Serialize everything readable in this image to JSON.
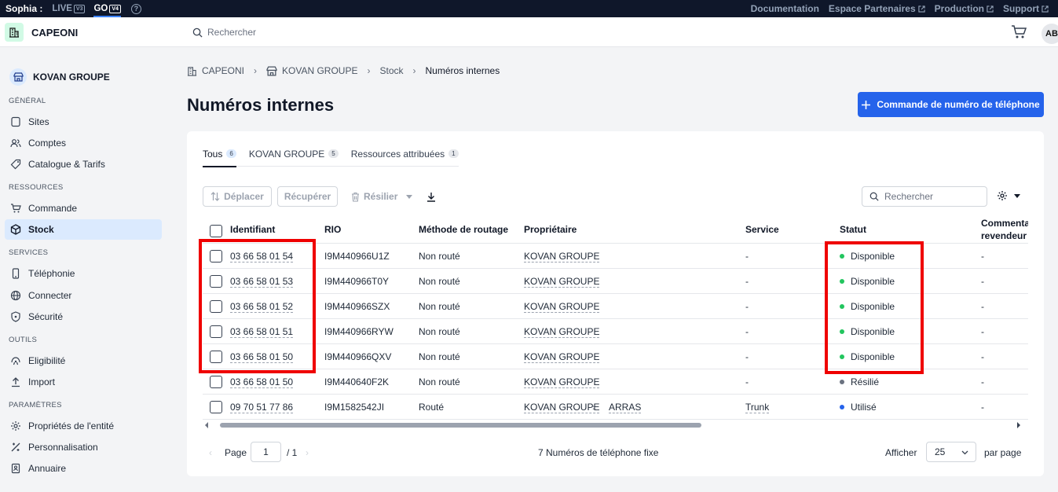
{
  "topbar": {
    "brand": "Sophia :",
    "env_live": "LIVE",
    "env_live_version": "V3",
    "env_go": "GO",
    "env_go_version": "V4",
    "help": "?",
    "links": [
      "Documentation",
      "Espace Partenaires",
      "Production",
      "Support"
    ]
  },
  "header": {
    "app_name": "CAPEONI",
    "search_placeholder": "Rechercher",
    "avatar": "AB"
  },
  "sidebar": {
    "entity": "KOVAN GROUPE",
    "sections": {
      "general": "GÉNÉRAL",
      "ressources": "RESSOURCES",
      "services": "SERVICES",
      "outils": "OUTILS",
      "parametres": "PARAMÈTRES"
    },
    "items": [
      {
        "label": "Sites",
        "icon": "map-pin-icon"
      },
      {
        "label": "Comptes",
        "icon": "users-icon"
      },
      {
        "label": "Catalogue & Tarifs",
        "icon": "tag-icon"
      },
      {
        "label": "Commande",
        "icon": "cart-icon"
      },
      {
        "label": "Stock",
        "icon": "box-icon",
        "active": true
      },
      {
        "label": "Téléphonie",
        "icon": "phone-icon"
      },
      {
        "label": "Connecter",
        "icon": "globe-icon"
      },
      {
        "label": "Sécurité",
        "icon": "shield-icon"
      },
      {
        "label": "Eligibilité",
        "icon": "eligibility-icon"
      },
      {
        "label": "Import",
        "icon": "upload-icon"
      },
      {
        "label": "Propriétés de l'entité",
        "icon": "gear-icon"
      },
      {
        "label": "Personnalisation",
        "icon": "customize-icon"
      },
      {
        "label": "Annuaire",
        "icon": "directory-icon"
      }
    ]
  },
  "breadcrumb": [
    "CAPEONI",
    "KOVAN GROUPE",
    "Stock",
    "Numéros internes"
  ],
  "page_title": "Numéros internes",
  "cta_label": "Commande de numéro de téléphone",
  "tabs": [
    {
      "label": "Tous",
      "count": "6"
    },
    {
      "label": "KOVAN GROUPE",
      "count": "5"
    },
    {
      "label": "Ressources attribuées",
      "count": "1"
    }
  ],
  "toolbar": {
    "move": "Déplacer",
    "recover": "Récupérer",
    "terminate": "Résilier",
    "search_placeholder": "Rechercher"
  },
  "table": {
    "columns": [
      "Identifiant",
      "RIO",
      "Méthode de routage",
      "Propriétaire",
      "Service",
      "Statut",
      "Commentaire revendeur"
    ],
    "rows": [
      {
        "id": "03 66 58 01 54",
        "rio": "I9M440966U1Z",
        "routing": "Non routé",
        "owner": "KOVAN GROUPE",
        "owner2": "",
        "service": "-",
        "status": "Disponible",
        "status_color": "#22c55e",
        "comment": "-"
      },
      {
        "id": "03 66 58 01 53",
        "rio": "I9M440966T0Y",
        "routing": "Non routé",
        "owner": "KOVAN GROUPE",
        "owner2": "",
        "service": "-",
        "status": "Disponible",
        "status_color": "#22c55e",
        "comment": "-"
      },
      {
        "id": "03 66 58 01 52",
        "rio": "I9M440966SZX",
        "routing": "Non routé",
        "owner": "KOVAN GROUPE",
        "owner2": "",
        "service": "-",
        "status": "Disponible",
        "status_color": "#22c55e",
        "comment": "-"
      },
      {
        "id": "03 66 58 01 51",
        "rio": "I9M440966RYW",
        "routing": "Non routé",
        "owner": "KOVAN GROUPE",
        "owner2": "",
        "service": "-",
        "status": "Disponible",
        "status_color": "#22c55e",
        "comment": "-"
      },
      {
        "id": "03 66 58 01 50",
        "rio": "I9M440966QXV",
        "routing": "Non routé",
        "owner": "KOVAN GROUPE",
        "owner2": "",
        "service": "-",
        "status": "Disponible",
        "status_color": "#22c55e",
        "comment": "-"
      },
      {
        "id": "03 66 58 01 50",
        "rio": "I9M440640F2K",
        "routing": "Non routé",
        "owner": "KOVAN GROUPE",
        "owner2": "",
        "service": "-",
        "status": "Résilié",
        "status_color": "#6b7280",
        "comment": "-"
      },
      {
        "id": "09 70 51 77 86",
        "rio": "I9M1582542JI",
        "routing": "Routé",
        "owner": "KOVAN GROUPE",
        "owner2": "ARRAS",
        "service": "Trunk",
        "status": "Utilisé",
        "status_color": "#2563eb",
        "comment": "-"
      }
    ]
  },
  "pagination": {
    "page_label": "Page",
    "page_value": "1",
    "page_total": "/ 1",
    "summary": "7 Numéros de téléphone fixe",
    "per_page_prefix": "Afficher",
    "per_page_value": "25",
    "per_page_suffix": "par page"
  },
  "colors": {
    "accent": "#2563eb",
    "highlight": "#ef0000",
    "active_nav": "#dbeafe"
  }
}
